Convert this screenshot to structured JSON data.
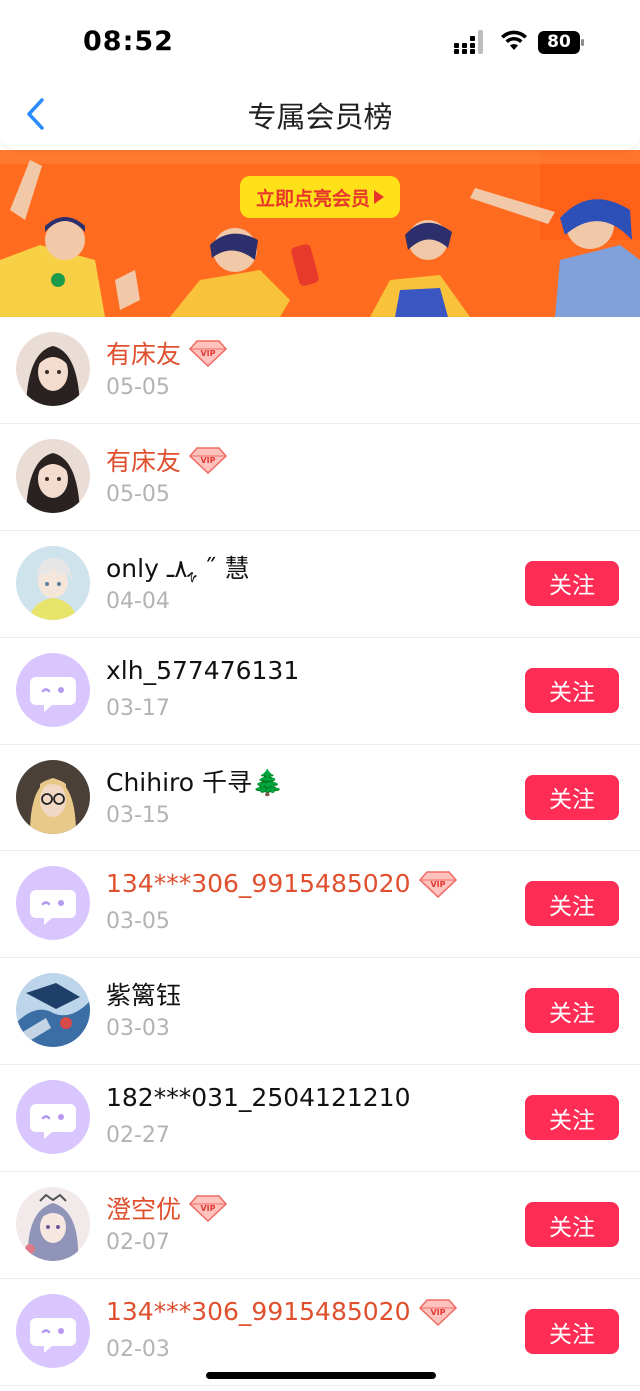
{
  "status_bar": {
    "time": "08:52",
    "battery": "80"
  },
  "nav": {
    "title": "专属会员榜"
  },
  "banner": {
    "cta_label": "立即点亮会员"
  },
  "members": [
    {
      "name": "有床友",
      "date": "05-05",
      "vip": true,
      "follow_label": "",
      "avatar": "photo-girl"
    },
    {
      "name": "有床友",
      "date": "05-05",
      "vip": true,
      "follow_label": "",
      "avatar": "photo-girl"
    },
    {
      "name": "only ﮩ٨ـ ˝ 慧",
      "date": "04-04",
      "vip": false,
      "follow_label": "关注",
      "avatar": "anime-boy"
    },
    {
      "name": "xlh_577476131",
      "date": "03-17",
      "vip": false,
      "follow_label": "关注",
      "avatar": "default-chat"
    },
    {
      "name": "Chihiro 千寻🌲",
      "date": "03-15",
      "vip": false,
      "follow_label": "关注",
      "avatar": "photo-glasses"
    },
    {
      "name": "134***306_9915485020",
      "date": "03-05",
      "vip": true,
      "follow_label": "关注",
      "avatar": "default-chat"
    },
    {
      "name": "紫篱钰",
      "date": "03-03",
      "vip": false,
      "follow_label": "关注",
      "avatar": "anime-blue"
    },
    {
      "name": "182***031_2504121210",
      "date": "02-27",
      "vip": false,
      "follow_label": "关注",
      "avatar": "default-chat"
    },
    {
      "name": "澄空优",
      "date": "02-07",
      "vip": true,
      "follow_label": "关注",
      "avatar": "anime-silver"
    },
    {
      "name": "134***306_9915485020",
      "date": "02-03",
      "vip": true,
      "follow_label": "关注",
      "avatar": "default-chat"
    }
  ],
  "colors": {
    "vip_name": "#e0502f",
    "follow_button": "#ff2d55",
    "banner_bg": "#ff6b1f",
    "default_avatar_bg": "#d9c6ff"
  }
}
